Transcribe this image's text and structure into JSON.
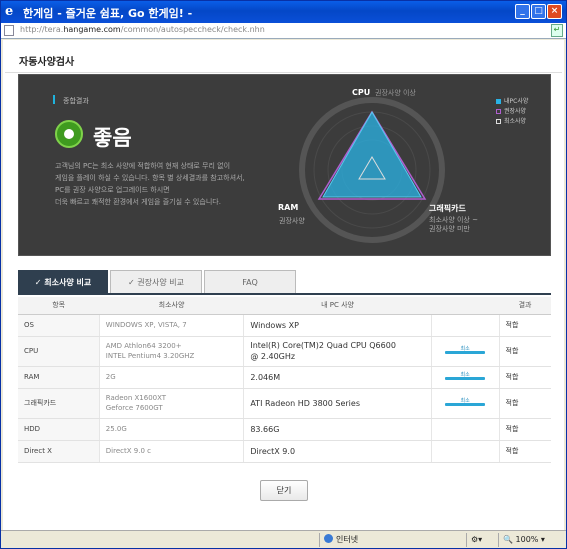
{
  "window": {
    "title": "한게임 - 즐거운 쉼표, Go 한게임! -",
    "minimize": "_",
    "maximize": "□",
    "close": "×"
  },
  "address": {
    "prefix": "http://tera.",
    "domain": "hangame.com",
    "path": "/common/autospeccheck/check.nhn"
  },
  "page": {
    "title": "자동사양검사"
  },
  "summary": {
    "label": "종합결과",
    "result": "좋음",
    "description": [
      "고객님의 PC는 최소 사양에 적합하여 현재 상태로 무리 없이",
      "게임을 플레이 하실 수 있습니다. 항목 별 상세결과를 참고하셔서,",
      "PC를 권장 사양으로 업그레이드 하시면",
      "더욱 빠르고 쾌적한 환경에서 게임을 즐기실 수 있습니다."
    ]
  },
  "radar": {
    "cpu": {
      "label": "CPU",
      "sub": "권장사양 이상"
    },
    "gpu": {
      "label": "그래픽카드",
      "sub1": "최소사양 이상 ~",
      "sub2": "권장사양 미만"
    },
    "ram": {
      "label": "RAM",
      "sub": "권장사양"
    },
    "legend": [
      {
        "label": "내PC사양",
        "color": "#29b3e6"
      },
      {
        "label": "권장사양",
        "color": "#b05fd0"
      },
      {
        "label": "최소사양",
        "color": "#dddddd"
      }
    ]
  },
  "tabs": [
    {
      "label": "최소사양 비교",
      "active": true
    },
    {
      "label": "권장사양 비교",
      "active": false
    },
    {
      "label": "FAQ",
      "active": false
    }
  ],
  "table": {
    "headers": [
      "항목",
      "최소사양",
      "내 PC 사양",
      "",
      "결과"
    ],
    "rows": [
      {
        "item": "OS",
        "min": "WINDOWS XP,  VISTA,  7",
        "mine": "Windows XP",
        "bar": "",
        "result": "적합"
      },
      {
        "item": "CPU",
        "min": "AMD Athlon64 3200+\nINTEL Pentium4 3.20GHZ",
        "mine": "Intel(R) Core(TM)2 Quad CPU Q6600\n@ 2.40GHz",
        "bar": "최소",
        "result": "적합"
      },
      {
        "item": "RAM",
        "min": "2G",
        "mine": "2.046M",
        "bar": "최소",
        "result": "적합"
      },
      {
        "item": "그래픽카드",
        "min": "Radeon X1600XT\nGeforce 7600GT",
        "mine": "ATI Radeon HD 3800 Series",
        "bar": "최소",
        "result": "적합"
      },
      {
        "item": "HDD",
        "min": "25.0G",
        "mine": "83.66G",
        "bar": "",
        "result": "적합"
      },
      {
        "item": "Direct X",
        "min": "DirectX 9.0 c",
        "mine": "DirectX 9.0",
        "bar": "",
        "result": "적합"
      }
    ]
  },
  "buttons": {
    "close": "닫기"
  },
  "status": {
    "zone": "인터넷",
    "zoom": "100%"
  }
}
